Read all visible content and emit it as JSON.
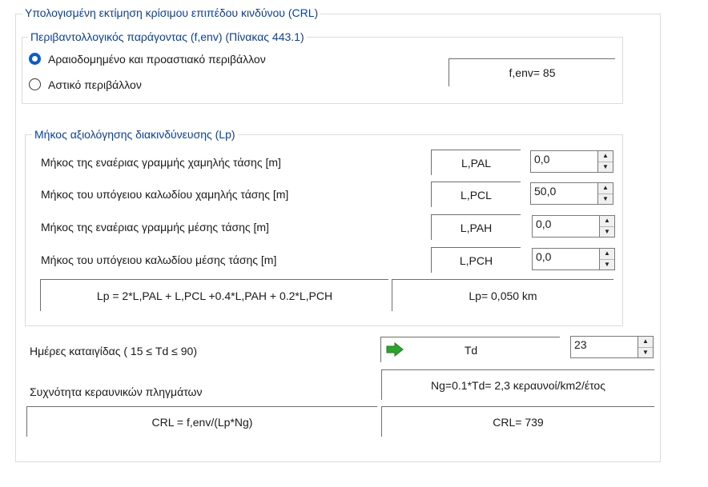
{
  "crl_group": {
    "title": "Υπολογισμένη εκτίμηση κρίσιμου επιπέδου κινδύνου (CRL)"
  },
  "env_group": {
    "title": "Περιβαντολλογικός παράγοντας (f,env) (Πίνακας 443.1)",
    "options": [
      {
        "label": "Αραιοδομημένο και προαστιακό περιβάλλον",
        "selected": true
      },
      {
        "label": "Αστικό περιβάλλον",
        "selected": false
      }
    ],
    "result": "f,env= 85"
  },
  "lp_group": {
    "title": "Μήκος αξιολόγησης διακινδύνευσης (Lp)",
    "rows": [
      {
        "label": "Μήκος της εναέριας γραμμής χαμηλής τάσης [m]",
        "symbol": "L,PAL",
        "value": "0,0"
      },
      {
        "label": "Μήκος του υπόγειου καλωδίου χαμηλής τάσης [m]",
        "symbol": "L,PCL",
        "value": "50,0"
      },
      {
        "label": "Μήκος της εναέριας γραμμής μέσης τάσης [m]",
        "symbol": "L,PAH",
        "value": "0,0"
      },
      {
        "label": "Μήκος του υπόγειου καλωδίου μέσης τάσης [m]",
        "symbol": "L,PCH",
        "value": "0,0"
      }
    ],
    "formula": "Lp = 2*L,PAL + L,PCL +0.4*L,PAH + 0.2*L,PCH",
    "result": "Lp= 0,050  km"
  },
  "storm_days": {
    "label": "Ημέρες καταιγίδας ( 15 ≤ Td ≤ 90)",
    "symbol": "Td",
    "value": "23"
  },
  "flash_density": {
    "label": "Συχνότητα κεραυνικών πληγμάτων",
    "result": "Ng=0.1*Td= 2,3  κεραυνοί/km2/έτος"
  },
  "crl": {
    "formula": "CRL = f,env/(Lp*Ng)",
    "result": "CRL= 739"
  },
  "icons": {
    "up": "▲",
    "down": "▼"
  },
  "colors": {
    "legend": "#0b3fa8",
    "radio_selected": "#0a5ad4",
    "arrow": "#2aa62a"
  }
}
